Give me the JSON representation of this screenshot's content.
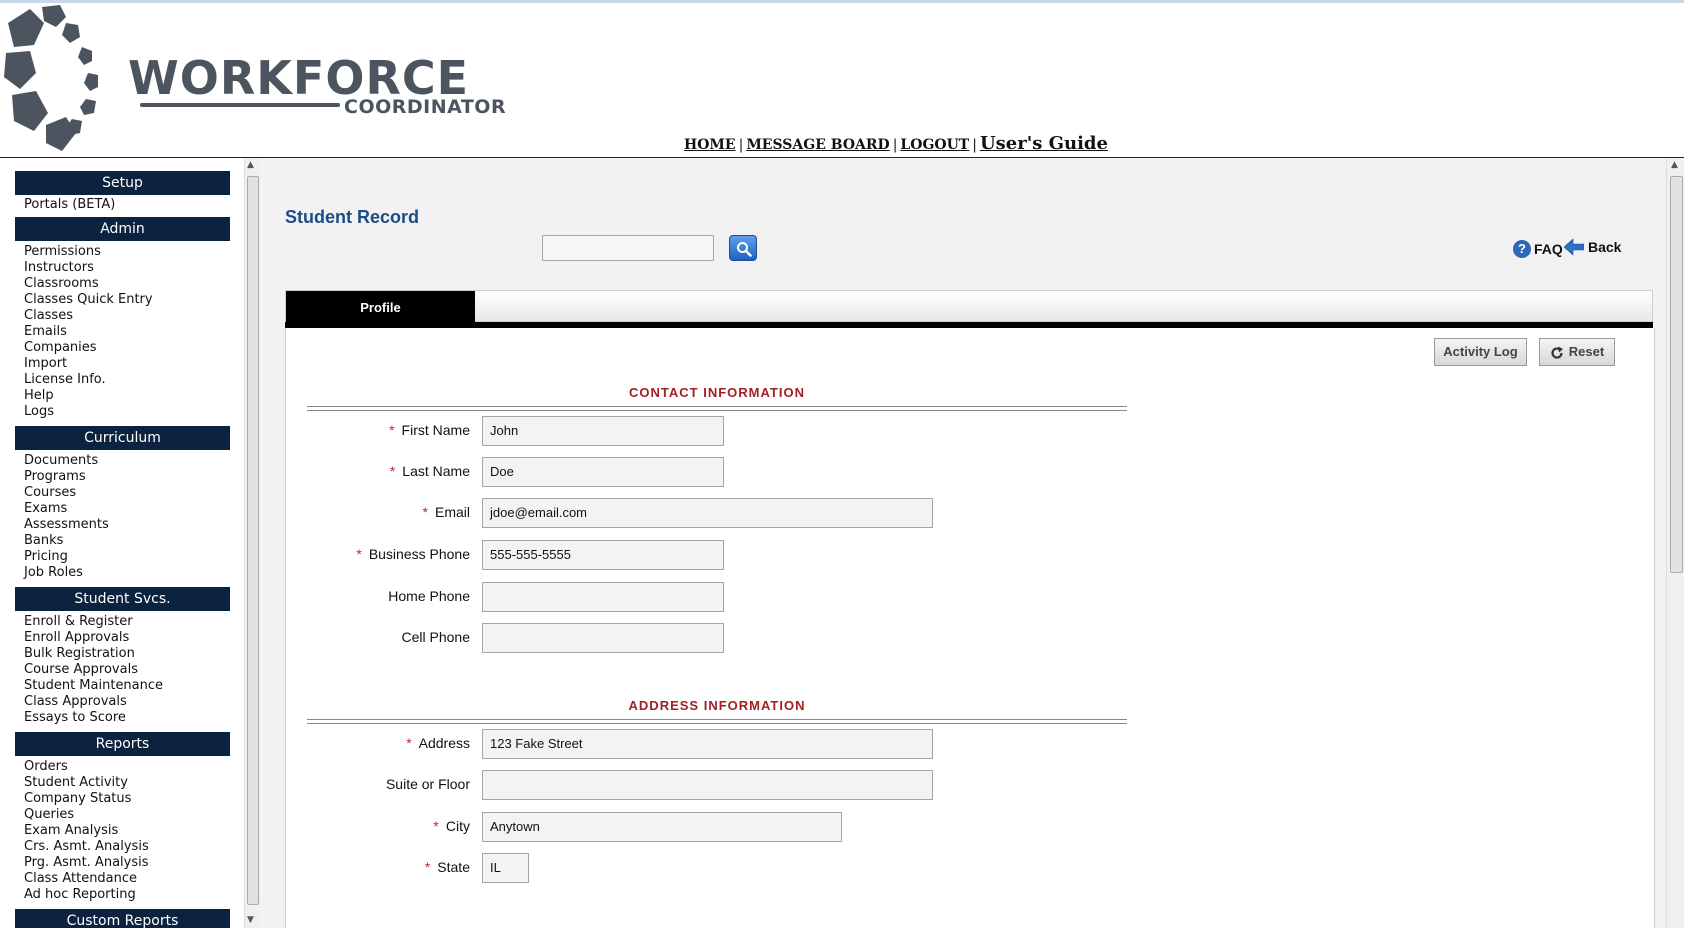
{
  "header": {
    "logo_text": "WORKFORCE",
    "logo_subtext": "COORDINATOR",
    "nav": [
      {
        "label": "HOME"
      },
      {
        "label": "MESSAGE BOARD"
      },
      {
        "label": "LOGOUT"
      }
    ],
    "users_guide": "User's Guide"
  },
  "sidebar": {
    "setup": {
      "title": "Setup",
      "items": [
        "Portals (BETA)"
      ]
    },
    "admin": {
      "title": "Admin",
      "items": [
        "Permissions",
        "Instructors",
        "Classrooms",
        "Classes Quick Entry",
        "Classes",
        "Emails",
        "Companies",
        "Import",
        "License Info.",
        "Help",
        "Logs"
      ]
    },
    "curriculum": {
      "title": "Curriculum",
      "items": [
        "Documents",
        "Programs",
        "Courses",
        "Exams",
        "Assessments",
        "Banks",
        "Pricing",
        "Job Roles"
      ]
    },
    "student_svcs": {
      "title": "Student Svcs.",
      "items": [
        "Enroll & Register",
        "Enroll Approvals",
        "Bulk Registration",
        "Course Approvals",
        "Student Maintenance",
        "Class Approvals",
        "Essays to Score"
      ]
    },
    "reports": {
      "title": "Reports",
      "items": [
        "Orders",
        "Student Activity",
        "Company Status",
        "Queries",
        "Exam Analysis",
        "Crs. Asmt. Analysis",
        "Prg. Asmt. Analysis",
        "Class Attendance",
        "Ad hoc Reporting"
      ]
    },
    "custom_reports": {
      "title": "Custom Reports"
    }
  },
  "main": {
    "title": "Student Record",
    "search": {
      "value": ""
    },
    "faq": "FAQ",
    "back": "Back",
    "tab": "Profile",
    "buttons": {
      "activity_log": "Activity Log",
      "reset": "Reset"
    },
    "contact": {
      "title": "CONTACT INFORMATION",
      "fields": [
        {
          "label": "First Name",
          "required": "*",
          "value": "John"
        },
        {
          "label": "Last Name",
          "required": "*",
          "value": "Doe"
        },
        {
          "label": "Email",
          "required": "*",
          "value": "jdoe@email.com"
        },
        {
          "label": "Business Phone",
          "required": "*",
          "value": "555-555-5555"
        },
        {
          "label": "Home Phone",
          "required": "",
          "value": ""
        },
        {
          "label": "Cell Phone",
          "required": "",
          "value": ""
        }
      ]
    },
    "address": {
      "title": "ADDRESS INFORMATION",
      "fields": [
        {
          "label": "Address",
          "required": "*",
          "value": "123 Fake Street"
        },
        {
          "label": "Suite or Floor",
          "required": "",
          "value": ""
        },
        {
          "label": "City",
          "required": "*",
          "value": "Anytown"
        },
        {
          "label": "State",
          "required": "*",
          "value": "IL"
        }
      ]
    }
  }
}
